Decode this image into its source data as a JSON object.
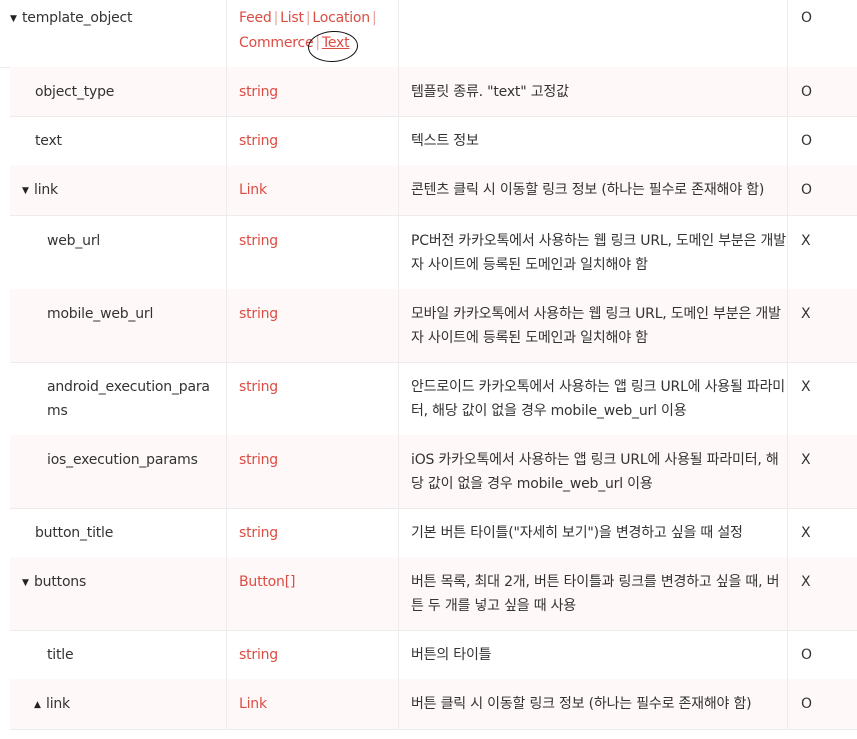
{
  "rows": [
    {
      "name": "template_object",
      "expand": "▼",
      "types": [
        "Feed",
        "List",
        "Location",
        "Commerce",
        "Text"
      ],
      "current_type": "Text",
      "desc": "",
      "required": "O"
    },
    {
      "name": "object_type",
      "type": "string",
      "desc": "템플릿 종류. \"text\" 고정값",
      "required": "O"
    },
    {
      "name": "text",
      "type": "string",
      "desc": "텍스트 정보",
      "required": "O"
    },
    {
      "name": "link",
      "expand": "▼",
      "type": "Link",
      "desc": "콘텐츠 클릭 시 이동할 링크 정보 (하나는 필수로 존재해야 함)",
      "required": "O"
    },
    {
      "name": "web_url",
      "type": "string",
      "desc1": "PC버전 카카오톡에서 사용하는 웹 링크 URL, 도메인 부분은 개발",
      "desc2": "자 사이트에 등록된 도메인과 일치해야 함",
      "required": "X"
    },
    {
      "name": "mobile_web_url",
      "type": "string",
      "desc1": "모바일 카카오톡에서 사용하는 웹 링크 URL, 도메인 부분은 개발",
      "desc2": "자 사이트에 등록된 도메인과 일치해야 함",
      "required": "X"
    },
    {
      "name1": "android_execution_para",
      "name2": "ms",
      "type": "string",
      "desc1": "안드로이드 카카오톡에서 사용하는 앱 링크 URL에 사용될 파라미",
      "desc2": "터, 해당 값이 없을 경우 mobile_web_url 이용",
      "required": "X"
    },
    {
      "name": "ios_execution_params",
      "type": "string",
      "desc1": "iOS 카카오톡에서 사용하는 앱 링크 URL에 사용될 파라미터, 해",
      "desc2": "당 값이 없을 경우 mobile_web_url 이용",
      "required": "X"
    },
    {
      "name": "button_title",
      "type": "string",
      "desc": "기본 버튼 타이틀(\"자세히 보기\")을 변경하고 싶을 때 설정",
      "required": "X"
    },
    {
      "name": "buttons",
      "expand": "▼",
      "type": "Button[]",
      "desc1": "버튼 목록, 최대 2개, 버튼 타이틀과 링크를 변경하고 싶을 때, 버",
      "desc2": "튼 두 개를 넣고 싶을 때 사용",
      "required": "X"
    },
    {
      "name": "title",
      "type": "string",
      "desc": "버튼의 타이틀",
      "required": "O"
    },
    {
      "name": "link",
      "expand": "▲",
      "type": "Link",
      "desc": "버튼 클릭 시 이동할 링크 정보 (하나는 필수로 존재해야 함)",
      "required": "O"
    }
  ]
}
